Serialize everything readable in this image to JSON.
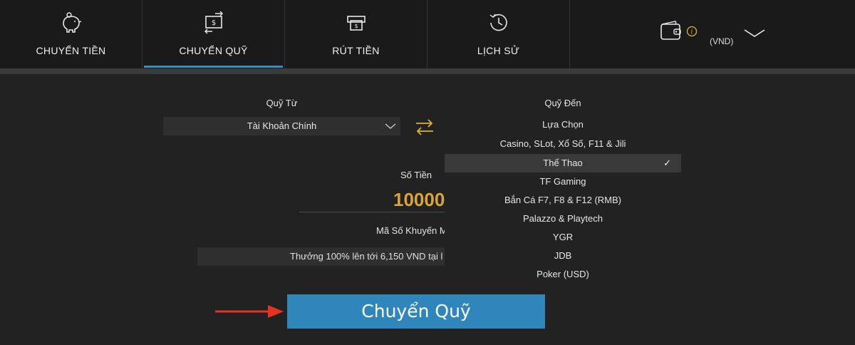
{
  "nav": {
    "tabs": [
      {
        "label": "CHUYỂN TIỀN",
        "icon": "piggy-bank-icon"
      },
      {
        "label": "CHUYỂN QUỸ",
        "icon": "money-transfer-icon",
        "active": true
      },
      {
        "label": "RÚT TIỀN",
        "icon": "cash-withdraw-icon"
      },
      {
        "label": "LỊCH SỬ",
        "icon": "history-clock-icon"
      }
    ],
    "wallet": {
      "currency": "(VND)",
      "icon": "wallet-icon",
      "info_icon": "info-icon"
    }
  },
  "form": {
    "from_label": "Quỹ Từ",
    "from_value": "Tài Khoản Chính",
    "to_label": "Quỹ Đến",
    "amount_label": "Số Tiền",
    "amount_value": "10000",
    "promo_label": "Mã Số Khuyến M",
    "promo_value": "Thưởng 100% lên tới 6,150 VND tại l",
    "submit_label": "Chuyển Quỹ"
  },
  "dropdown": {
    "items": [
      "Lựa Chọn",
      "Casino, SLot, Xổ Số, F11 & Jili",
      "Thể Thao",
      "TF Gaming",
      "Bắn Cá F7, F8 & F12 (RMB)",
      "Palazzo & Playtech",
      "YGR",
      "JDB",
      "Poker (USD)"
    ],
    "selected": "Thể Thao",
    "check_mark": "✓"
  },
  "colors": {
    "accent": "#2e86bb",
    "amount": "#d9a43a",
    "swap_icon": "#e0b22a",
    "arrow": "#e53223"
  }
}
